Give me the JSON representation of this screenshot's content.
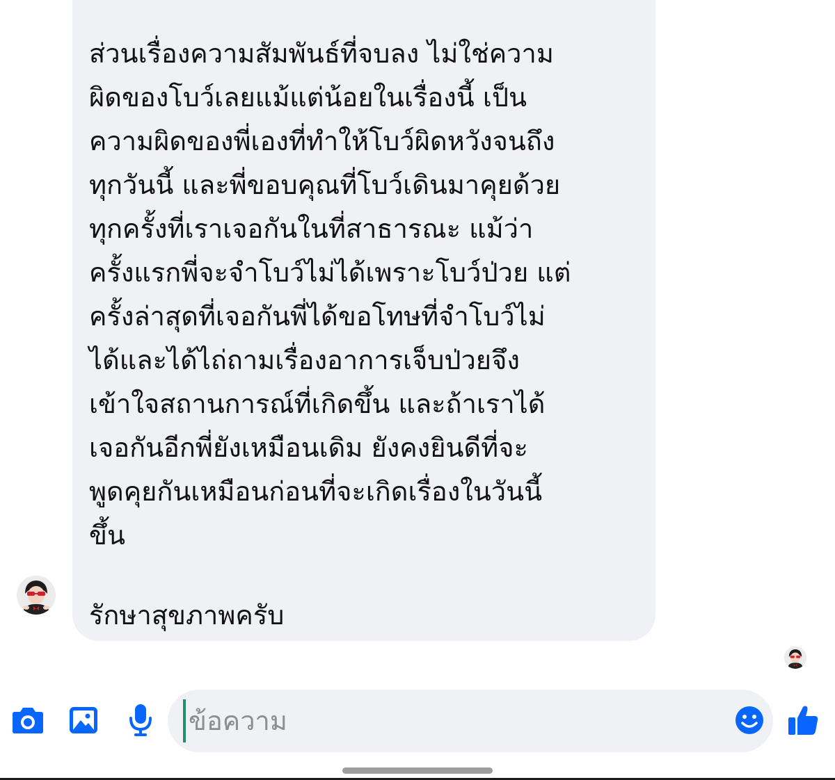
{
  "conversation": {
    "message": {
      "body": "ส่วนเรื่องความสัมพันธ์ที่จบลง ไม่ใช่ความ\nผิดของโบว์เลยแม้แต่น้อยในเรื่องนี้ เป็น\nความผิดของพี่เองที่ทำให้โบว์ผิดหวังจนถึง\nทุกวันนี้ และพี่ขอบคุณที่โบว์เดินมาคุยด้วย\nทุกครั้งที่เราเจอกันในที่สาธารณะ แม้ว่า\nครั้งแรกพี่จะจำโบว์ไม่ได้เพราะโบว์ป่วย แต่\nครั้งล่าสุดที่เจอกันพี่ได้ขอโทษที่จำโบว์ไม่\nได้และได้ไถ่ถามเรื่องอาการเจ็บป่วยจึง\nเข้าใจสถานการณ์ที่เกิดขึ้น และถ้าเราได้\nเจอกันอีกพี่ยังเหมือนเดิม ยังคงยินดีที่จะ\nพูดคุยกันเหมือนก่อนที่จะเกิดเรื่องในวันนี้\nขึ้น",
      "signoff": "รักษาสุขภาพครับ"
    }
  },
  "composer": {
    "placeholder": "ข้อความ",
    "value": ""
  },
  "icons": {
    "camera": "camera-icon",
    "photo": "photo-icon",
    "microphone": "microphone-icon",
    "emoji": "emoji-icon",
    "like": "thumbs-up-icon"
  },
  "colors": {
    "accent": "#0866ff",
    "bubble": "#f0f1f5",
    "text": "#111111",
    "placeholder": "#8a8d91",
    "caret": "#1f8f6f"
  }
}
